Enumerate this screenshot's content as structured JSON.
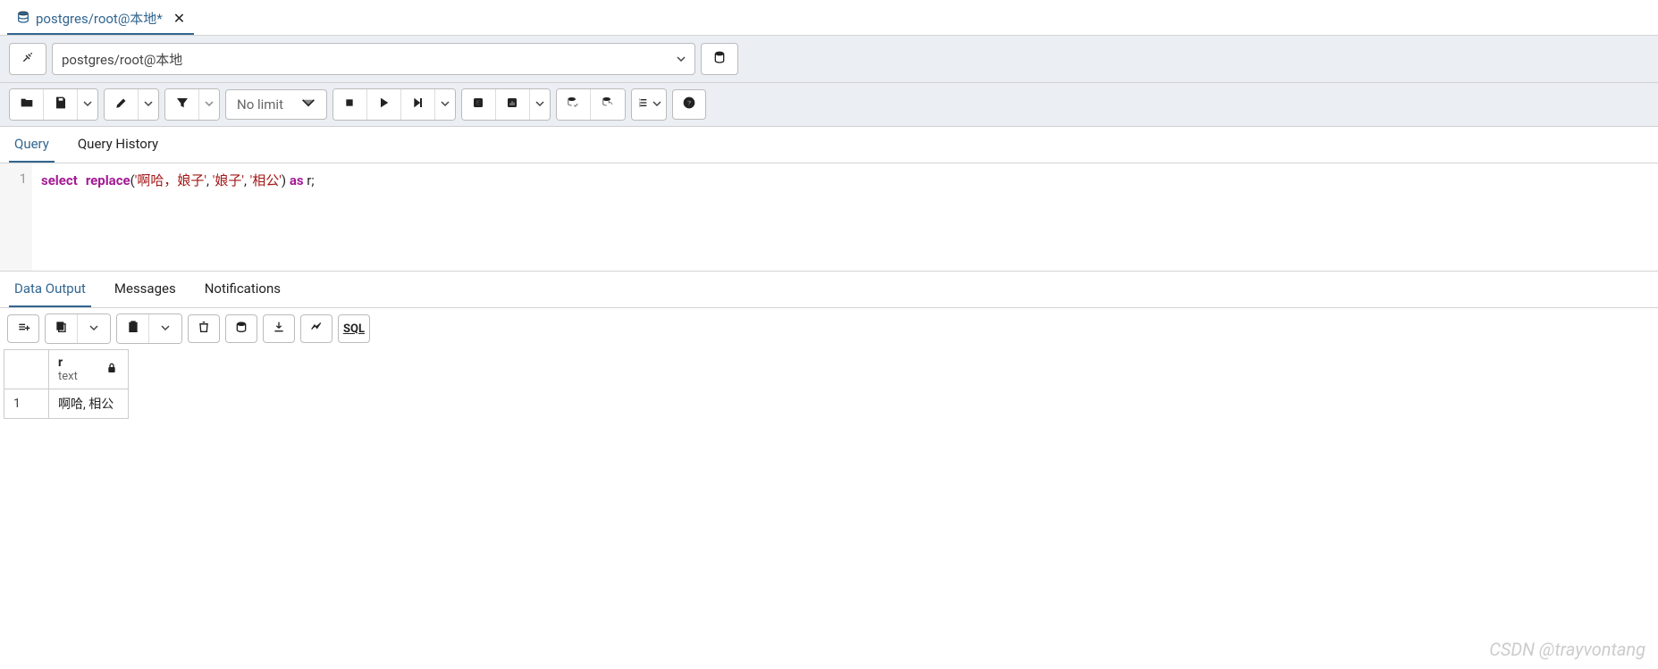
{
  "tab": {
    "title": "postgres/root@本地*"
  },
  "connection": {
    "label": "postgres/root@本地"
  },
  "toolbar": {
    "limit_label": "No limit"
  },
  "query_tabs": {
    "query": "Query",
    "history": "Query History"
  },
  "editor": {
    "line_number": "1",
    "tokens": {
      "select": "select",
      "replace": "replace",
      "paren_open": "(",
      "str1": "'啊哈，娘子'",
      "comma1": ", ",
      "str2": "'娘子'",
      "comma2": ", ",
      "str3": "'相公'",
      "paren_close": ") ",
      "as": "as",
      "alias": " r",
      "semi": ";"
    }
  },
  "result_tabs": {
    "data_output": "Data Output",
    "messages": "Messages",
    "notifications": "Notifications"
  },
  "result_toolbar": {
    "sql": "SQL"
  },
  "grid": {
    "column": {
      "name": "r",
      "type": "text"
    },
    "row_number": "1",
    "cell_value": "啊哈, 相公"
  },
  "watermark": "CSDN @trayvontang"
}
